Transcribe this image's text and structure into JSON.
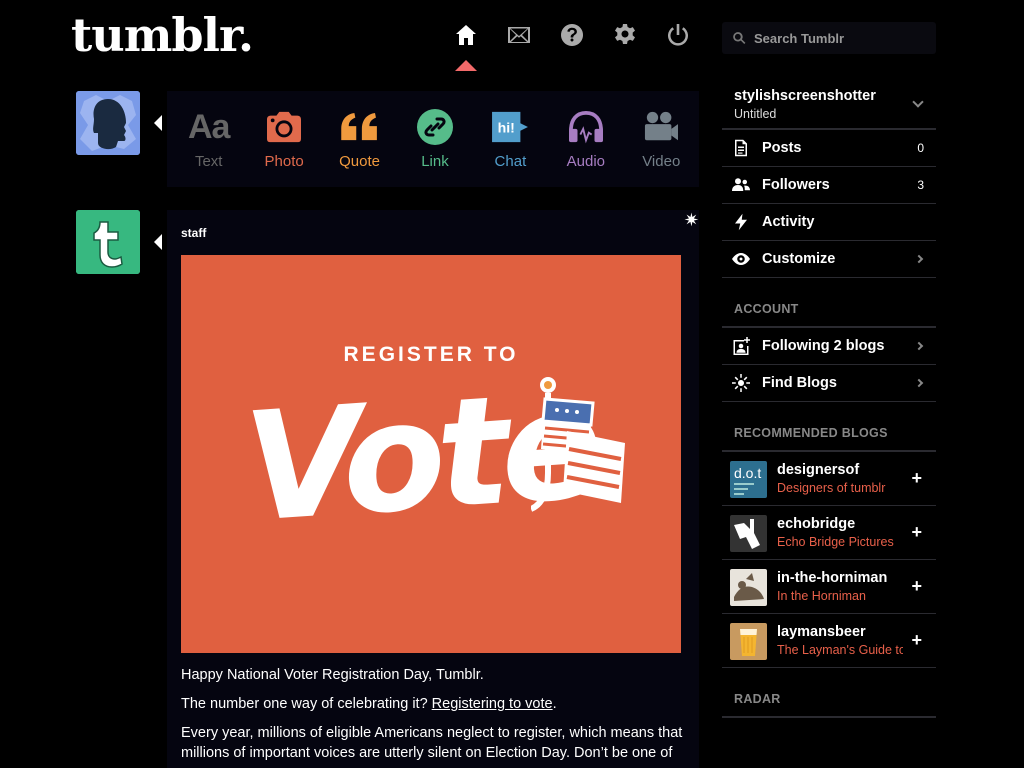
{
  "header": {
    "logo": "tumblr.",
    "nav": [
      {
        "name": "home-icon",
        "active": true
      },
      {
        "name": "mail-icon",
        "active": false
      },
      {
        "name": "help-icon",
        "active": false
      },
      {
        "name": "gear-icon",
        "active": false
      },
      {
        "name": "power-icon",
        "active": false
      }
    ],
    "search_placeholder": "Search Tumblr"
  },
  "post_types": [
    {
      "label": "Text",
      "color": "#666666",
      "icon": "text-icon"
    },
    {
      "label": "Photo",
      "color": "#e06a4c",
      "icon": "camera-icon"
    },
    {
      "label": "Quote",
      "color": "#f09a3e",
      "icon": "quote-icon"
    },
    {
      "label": "Link",
      "color": "#56bc8a",
      "icon": "link-icon"
    },
    {
      "label": "Chat",
      "color": "#529ecc",
      "icon": "chat-icon"
    },
    {
      "label": "Audio",
      "color": "#a77dc2",
      "icon": "headphones-icon"
    },
    {
      "label": "Video",
      "color": "#748089",
      "icon": "video-camera-icon"
    }
  ],
  "post": {
    "author": "staff",
    "image": {
      "line1": "REGISTER TO",
      "line2": "Vote",
      "bg": "#e06040"
    },
    "p1": "Happy National Voter Registration Day, Tumblr.",
    "p2_pre": "The number one way of celebrating it? ",
    "p2_link": "Registering to vote",
    "p2_post": ".",
    "p3": "Every year, millions of eligible Americans neglect to register, which means that millions of important voices are utterly silent on Election Day. Don’t be one of"
  },
  "sidebar": {
    "blog_name": "stylishscreenshotter",
    "blog_title": "Untitled",
    "stats": [
      {
        "label": "Posts",
        "count": "0",
        "icon": "document-icon"
      },
      {
        "label": "Followers",
        "count": "3",
        "icon": "people-icon"
      },
      {
        "label": "Activity",
        "count": "",
        "icon": "lightning-icon"
      },
      {
        "label": "Customize",
        "count": "",
        "icon": "eye-icon"
      }
    ],
    "account_head": "ACCOUNT",
    "account": [
      {
        "label": "Following 2 blogs",
        "icon": "add-person-icon"
      },
      {
        "label": "Find Blogs",
        "icon": "compass-icon"
      }
    ],
    "recommended_head": "RECOMMENDED BLOGS",
    "recommended": [
      {
        "name": "designersof",
        "title": "Designers of tumblr"
      },
      {
        "name": "echobridge",
        "title": "Echo Bridge Pictures"
      },
      {
        "name": "in-the-horniman",
        "title": "In the Horniman"
      },
      {
        "name": "laymansbeer",
        "title": "The Layman's Guide to Beer"
      }
    ],
    "radar_head": "RADAR"
  },
  "colors": {
    "accent": "#f36a6a",
    "link_red": "#e8604a",
    "background": "#000000",
    "panel": "#050510"
  }
}
